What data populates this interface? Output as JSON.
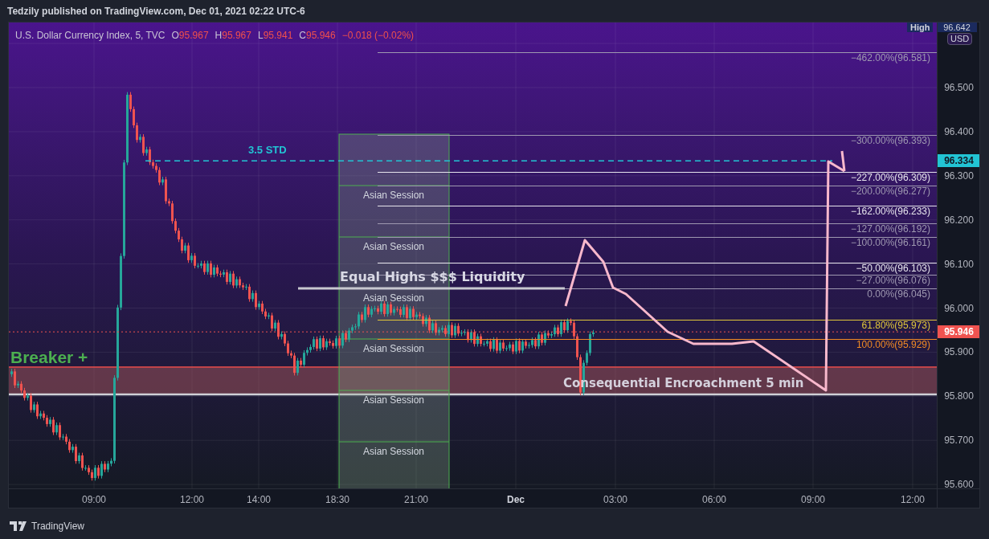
{
  "header": {
    "text": "Tedzily published on TradingView.com, Dec 01, 2021 02:22 UTC-6"
  },
  "legend": {
    "symbol": "U.S. Dollar Currency Index, 5, TVC",
    "values": [
      {
        "label": "O",
        "value": "95.967"
      },
      {
        "label": "H",
        "value": "95.967"
      },
      {
        "label": "L",
        "value": "95.941"
      },
      {
        "label": "C",
        "value": "95.946"
      }
    ],
    "change": "−0.018 (−0.02%)"
  },
  "sessions": [
    "Asian Session",
    "Asian Session",
    "Asian Session",
    "Asian Session",
    "Asian Session",
    "Asian Session"
  ],
  "std_line": {
    "label": "3.5 STD"
  },
  "liquidity_line": {
    "label": "Equal Highs $$$ Liquidity"
  },
  "breaker_label": "Breaker +",
  "encroachment_zone": {
    "label": "Consequential Encroachment 5 min"
  },
  "fib_levels": [
    {
      "label": "−462.00%(96.581)",
      "color": "#9e98b0"
    },
    {
      "label": "−300.00%(96.393)",
      "color": "#9e98b0"
    },
    {
      "label": "−227.00%(96.309)",
      "color": "#e6e4ec"
    },
    {
      "label": "−200.00%(96.277)",
      "color": "#9e98b0"
    },
    {
      "label": "−162.00%(96.233)",
      "color": "#e6e4ec"
    },
    {
      "label": "−127.00%(96.192)",
      "color": "#9e98b0"
    },
    {
      "label": "−100.00%(96.161)",
      "color": "#9e98b0"
    },
    {
      "label": "−50.00%(96.103)",
      "color": "#e6e4ec"
    },
    {
      "label": "−27.00%(96.076)",
      "color": "#9e98b0"
    },
    {
      "label": "0.00%(96.045)",
      "color": "#9e98b0"
    },
    {
      "label": "61.80%(95.973)",
      "color": "#e0c63a"
    },
    {
      "label": "100.00%(95.929)",
      "color": "#f08a24"
    }
  ],
  "price_axis": {
    "high_label": "High",
    "high_value": "96.642",
    "currency": "USD",
    "labels": [
      "96.500",
      "96.400",
      "96.300",
      "96.200",
      "96.100",
      "96.000",
      "95.900",
      "95.800",
      "95.700",
      "95.600"
    ],
    "markers": [
      {
        "value": "96.334",
        "color": "#22c4d4"
      },
      {
        "value": "95.946",
        "color": "#f05350"
      }
    ]
  },
  "time_axis": [
    {
      "text": "09:00",
      "kind": "time"
    },
    {
      "text": "12:00",
      "kind": "time"
    },
    {
      "text": "14:00",
      "kind": "time"
    },
    {
      "text": "18:30",
      "kind": "time"
    },
    {
      "text": "21:00",
      "kind": "time"
    },
    {
      "text": "Dec",
      "kind": "day"
    },
    {
      "text": "03:00",
      "kind": "time"
    },
    {
      "text": "06:00",
      "kind": "time"
    },
    {
      "text": "09:00",
      "kind": "time"
    },
    {
      "text": "12:00",
      "kind": "time"
    }
  ],
  "footer": {
    "brand": "TradingView"
  }
}
